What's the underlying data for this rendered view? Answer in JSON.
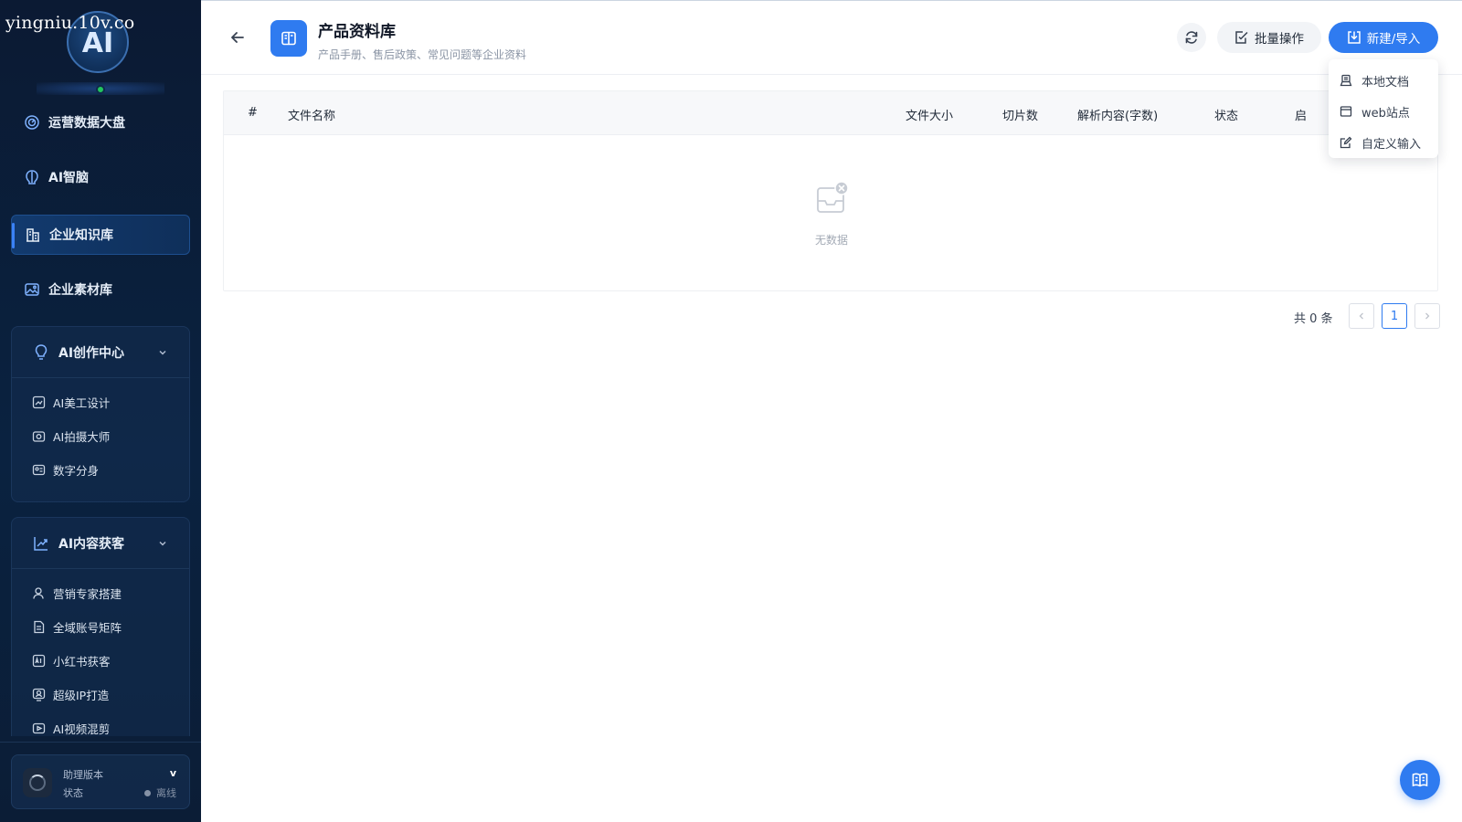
{
  "watermark": "yingniu.10v.co",
  "logo": {
    "text": "AI"
  },
  "sidebar": {
    "items": [
      {
        "label": "运营数据大盘",
        "icon": "dashboard-icon"
      },
      {
        "label": "AI智脑",
        "icon": "brain-icon"
      },
      {
        "label": "企业知识库",
        "icon": "knowledge-base-icon",
        "active": true
      },
      {
        "label": "企业素材库",
        "icon": "image-library-icon"
      }
    ],
    "groups": [
      {
        "label": "AI创作中心",
        "icon": "bulb-icon",
        "expanded": true,
        "items": [
          {
            "label": "AI美工设计",
            "icon": "design-icon"
          },
          {
            "label": "AI拍摄大师",
            "icon": "camera-icon"
          },
          {
            "label": "数字分身",
            "icon": "avatar-card-icon"
          }
        ]
      },
      {
        "label": "AI内容获客",
        "icon": "trend-icon",
        "expanded": true,
        "items": [
          {
            "label": "营销专家搭建",
            "icon": "user-icon"
          },
          {
            "label": "全域账号矩阵",
            "icon": "document-icon"
          },
          {
            "label": "小红书获客",
            "icon": "ai-badge-icon"
          },
          {
            "label": "超级IP打造",
            "icon": "ip-icon"
          },
          {
            "label": "AI视频混剪",
            "icon": "video-icon"
          }
        ]
      }
    ],
    "version": {
      "label": "助理版本",
      "value": "v",
      "state_label": "状态",
      "state_value": "离线"
    }
  },
  "header": {
    "title": "产品资料库",
    "subtitle": "产品手册、售后政策、常见问题等企业资料",
    "batch_label": "批量操作",
    "new_label": "新建/导入"
  },
  "dropdown": {
    "items": [
      {
        "label": "本地文档",
        "icon": "local-doc-icon"
      },
      {
        "label": "web站点",
        "icon": "web-site-icon"
      },
      {
        "label": "自定义输入",
        "icon": "edit-icon"
      }
    ]
  },
  "table": {
    "columns": [
      "#",
      "文件名称",
      "文件大小",
      "切片数",
      "解析内容(字数)",
      "状态",
      "启"
    ],
    "empty_text": "无数据"
  },
  "pagination": {
    "total_text": "共 0 条",
    "current_page": "1"
  },
  "colors": {
    "accent": "#2f7bf0",
    "sidebar_bg": "#0b1a33",
    "online": "#22c55e"
  }
}
